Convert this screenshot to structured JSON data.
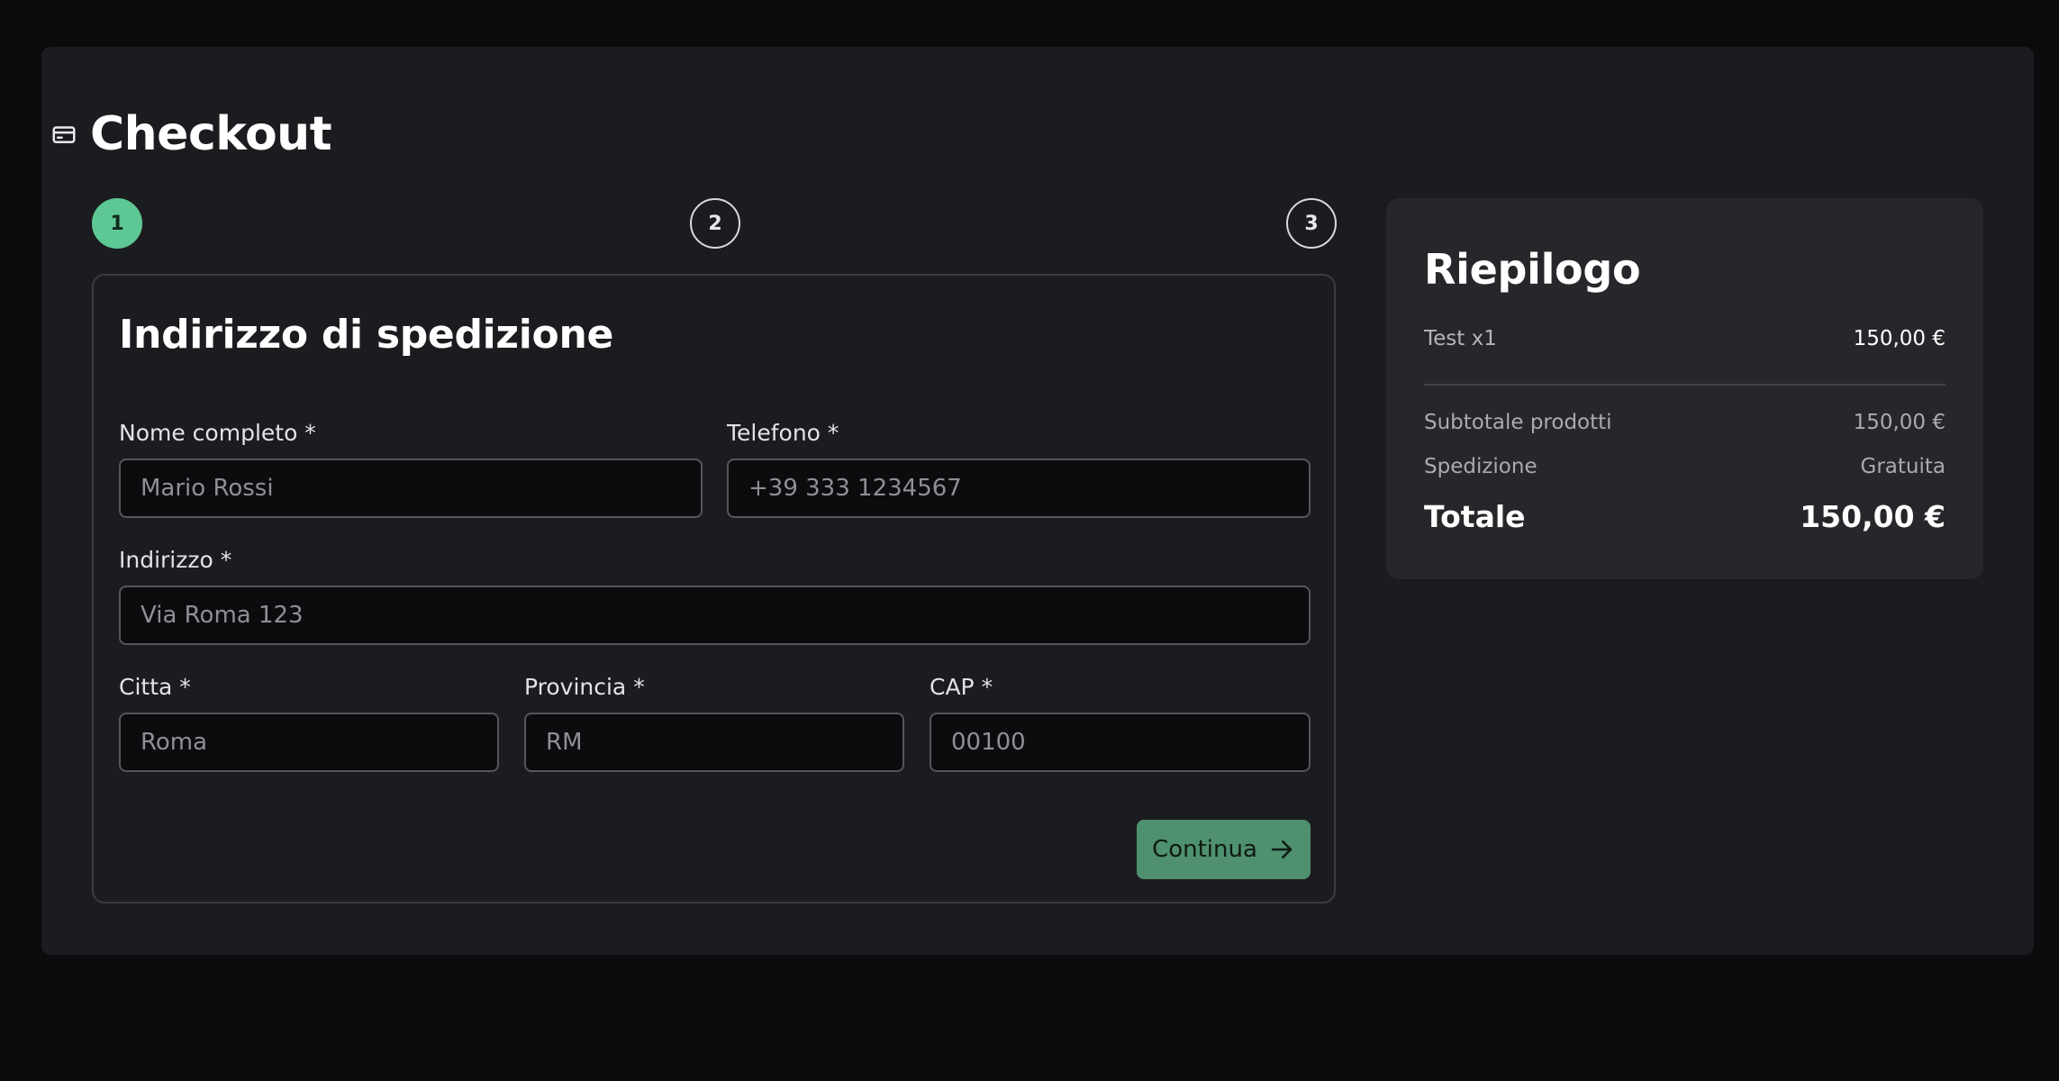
{
  "header": {
    "title": "Checkout",
    "icon": "credit-card-icon"
  },
  "stepper": {
    "steps": [
      "1",
      "2",
      "3"
    ],
    "active_index": 0,
    "active_color": "#5ec894"
  },
  "form": {
    "title": "Indirizzo di spedizione",
    "fields": {
      "nome": {
        "label": "Nome completo *",
        "placeholder": "Mario Rossi",
        "value": ""
      },
      "telefono": {
        "label": "Telefono *",
        "placeholder": "+39 333 1234567",
        "value": ""
      },
      "indirizzo": {
        "label": "Indirizzo *",
        "placeholder": "Via Roma 123",
        "value": ""
      },
      "citta": {
        "label": "Citta *",
        "placeholder": "Roma",
        "value": ""
      },
      "provincia": {
        "label": "Provincia *",
        "placeholder": "RM",
        "value": ""
      },
      "cap": {
        "label": "CAP *",
        "placeholder": "00100",
        "value": ""
      }
    },
    "continue_label": "Continua",
    "continue_icon": "arrow-right-icon",
    "accent_button_color": "#4f9070"
  },
  "summary": {
    "title": "Riepilogo",
    "items": [
      {
        "label": "Test x1",
        "price": "150,00 €"
      }
    ],
    "subtotal_label": "Subtotale prodotti",
    "subtotal_value": "150,00 €",
    "shipping_label": "Spedizione",
    "shipping_value": "Gratuita",
    "total_label": "Totale",
    "total_value": "150,00 €"
  }
}
